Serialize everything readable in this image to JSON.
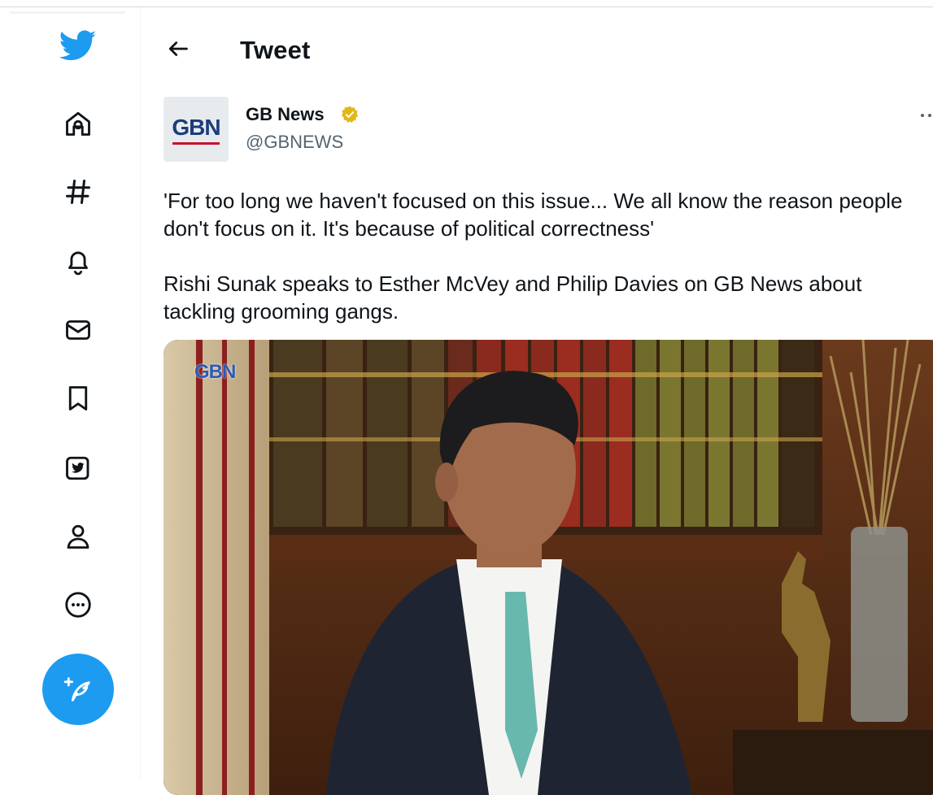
{
  "header": {
    "title": "Tweet"
  },
  "sidebar": {
    "items": [
      {
        "icon": "twitter-logo-icon"
      },
      {
        "icon": "home-icon"
      },
      {
        "icon": "explore-hashtag-icon"
      },
      {
        "icon": "notifications-bell-icon"
      },
      {
        "icon": "messages-envelope-icon"
      },
      {
        "icon": "bookmark-icon"
      },
      {
        "icon": "twitter-blue-icon"
      },
      {
        "icon": "profile-icon"
      },
      {
        "icon": "more-circle-icon"
      }
    ],
    "compose_icon": "compose-feather-icon"
  },
  "tweet": {
    "author_name": "GB News",
    "author_handle": "@GBNEWS",
    "avatar_logo": "GBN",
    "text_line1": "'For too long we haven't focused on this issue... We all know the reason people don't focus on it. It's because of political correctness'",
    "text_line2": "Rishi Sunak speaks to Esther McVey and Philip Davies on GB News about tackling grooming gangs.",
    "media_watermark": "GBN"
  },
  "colors": {
    "accent": "#1d9bf0",
    "verified_badge": "#e2b719",
    "handle_gray": "#536471"
  }
}
